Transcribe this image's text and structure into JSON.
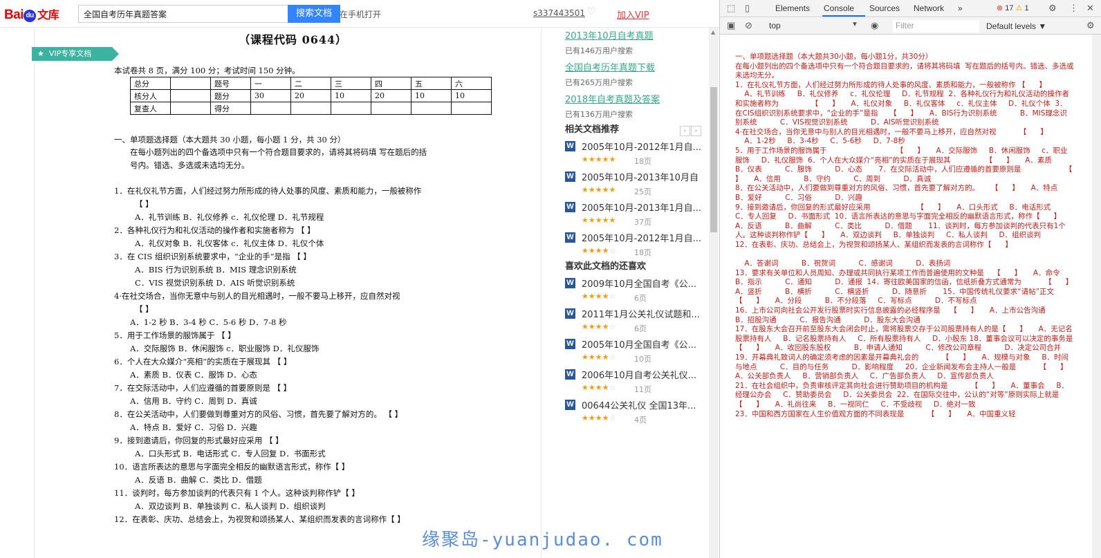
{
  "browser": {
    "logo": {
      "part1": "Bai",
      "paw": "du",
      "part2": "文库"
    },
    "search": {
      "value": "全国自考历年真题答案",
      "button": "搜索文档"
    },
    "open_on_phone": "在手机打开",
    "username": "s337443501",
    "join_vip": "加入VIP",
    "vip_tag": "VIP专享文档"
  },
  "document": {
    "title": "（课程代码 0644）",
    "intro": "本试卷共 8 页，满分 100 分；考试时间 150 分钟。",
    "score_table": [
      [
        "总分",
        "",
        "题号",
        "一",
        "二",
        "三",
        "四",
        "五",
        "六"
      ],
      [
        "核分人",
        "",
        "题分",
        "30",
        "20",
        "10",
        "20",
        "10",
        "10"
      ],
      [
        "复查人",
        "",
        "得分",
        "",
        "",
        "",
        "",
        "",
        ""
      ]
    ],
    "lines": [
      "一、单项题选择题（本大题共 30 小题，每小题 1 分，共 30 分）",
      "在每小题列出的四个备选项中只有一个符合题目要求的，请将其将码填   写在题后的括",
      "号内。错选、多选或未选均无分。",
      "1．在礼仪礼节方面，人们经过努力所形成的待人处事的风度、素质和能力，一般被称作",
      "【      】",
      "A．礼节训练     B．礼仪修养     c．礼仪伦理     D．礼节规程",
      "2．各种礼仪行为和礼仪活动的操作者和实施者称为              【      】",
      "A．礼仪对象     B．礼仪客体     c．礼仪主体     D．礼仪个体",
      "3．在 CIS 组织识别系统要求中，“企业的手”是指     【      】",
      "A．BIS 行为识别系统          B．MIS 理念识别系统",
      "C．VIS 视觉识别系统          D．AIS 听觉识别系统",
      "4·在社交场合，当你无意中与别人的目光相遇时，一般不要马上移开，应自然对视",
      "【      】",
      "A．1-2 秒     B．3-4 秒     C．5-6 秒     D．7-8 秒",
      "5．用于工作场景的服饰属于                              【      】",
      "A．交际服饰     B．休闲服饰     c．职业服饰     D．礼仪服饰",
      "6．个人在大众媒介“亮相”的实质在于展现其               【      】",
      "A．素质     B．仪表          C．服饰          D．心态",
      "7．在交际活动中，人们应遵循的首要原则是                   【      】",
      "A．信用          B．守约          C．周到          D．真诚",
      "8．在公关活动中，人们要做到尊重对方的风俗、习惯，首先要了解对方的。     【      】",
      "A．特点          B．爱好          C．习俗          D．兴趣",
      "9．接到邀请后，你回复的形式最好应采用                    【      】",
      "A．口头形式     B．电话形式     C．专人回复     D．书面形式",
      "10．语言所表达的意思与字面完全相反的幽默语言形式，称作【      】",
      "A．反语          B．曲解          C．类比          D．借题",
      "11．谈判时，每方参加谈判的代表只有 1 个人。这种谈判称作铲【      】",
      "A．双边谈判     B．单独谈判     C．私人谈判     D．组织谈判",
      "12．在表彰、庆功、总结会上，为视贺和颂扬某人、某组织而发表的言词称作【      】"
    ]
  },
  "sidebar": {
    "hot_searches": [
      {
        "title": "2013年10月自考真题",
        "count": "已有146万用户搜索"
      },
      {
        "title": "全国自考历年真题下载",
        "count": "已有265万用户搜索"
      },
      {
        "title": "2018年自考真题及答案",
        "count": "已有136万用户搜索"
      }
    ],
    "related_heading": "相关文档推荐",
    "related": [
      {
        "title": "2005年10月-2012年1月自...",
        "stars": 4.5,
        "pages": "18页"
      },
      {
        "title": "2005年10月-2013年10月自",
        "stars": 4.5,
        "pages": "25页"
      },
      {
        "title": "2005年10月-2013年1月自...",
        "stars": 4.5,
        "pages": "37页"
      },
      {
        "title": "2005年10月-2012年1月自...",
        "stars": 3.5,
        "pages": "18页"
      }
    ],
    "also_liked_heading": "喜欢此文档的还喜欢",
    "also_liked": [
      {
        "title": "2009年10月全国自考《公...",
        "stars": 4,
        "pages": "6页"
      },
      {
        "title": "2011年1月公关礼仪试题和...",
        "stars": 4,
        "pages": "6页"
      },
      {
        "title": "2005年10月全国自考《公...",
        "stars": 4,
        "pages": "10页"
      },
      {
        "title": "2006年10月自考公关礼仪...",
        "stars": 4,
        "pages": "11页"
      },
      {
        "title": "00644公关礼仪 全国13年...",
        "stars": 4,
        "pages": "4页"
      }
    ]
  },
  "watermark": "缘聚岛-yuanjudao. com",
  "devtools": {
    "tabs": [
      "Elements",
      "Console",
      "Sources",
      "Network"
    ],
    "active_tab": "Console",
    "more": "»",
    "errors": "17",
    "warnings": "1",
    "context": "top",
    "filter_placeholder": "Filter",
    "levels": "Default levels ▼",
    "console_text": "一、单项题选择题（本大题共30小题，每小题1分，共30分）\n在每小题列出的四个备选项中只有一个符合题目要求的，请将其将码填  写在题后的括号内。错选、多选或未选均无分。\n1．在礼仪礼节方面，人们经过努力所形成的待人处事的风度、素质和能力，一般被称作 【      】\n    A．礼节训练     B．礼仪修养     c．礼仪伦理     D．礼节规程  2．各种礼仪行为和礼仪活动的操作者和实施者称为              【      】     A．礼仪对象     B．礼仪客体     c．礼仪主体     D．礼仪个体  3．在CIS组织识别系统要求中，“企业的手”是指     【      】     A．BIS行为识别系统          B．MIS理念识别系统          C．VIS视觉识别系统          D．AIS听觉识别系统\n4·在社交场合，当你无意中与别人的目光相遇时，一般不要马上移开，应自然对视          【      】\n    A．1-2秒     B．3-4秒     C．5-6秒     D．7-8秒\n5．用于工作场景的服饰属于                              【      】     A．交际服饰     B．休闲服饰     c．职业服饰     D．礼仪服饰  6．个人在大众媒介“亮相”的实质在于展现其               【      】     A．素质     B．仪表          C．服饰          D．心态       7．在交际活动中，人们应遵循的首要原则是                   【      】     A．信用          B．守约          C．周到          D．真诚\n8．在公关活动中，人们要做到尊重对方的风俗、习惯，首先要了解对方的。     【      】     A．特点          B．爱好          C．习俗          D．兴趣\n9．接到邀请后，你回复的形式最好应采用                    【      】     A．口头形式     B．电话形式     C．专人回复     D．书面形式  10．语言所表达的意思与字面完全相反的幽默语言形式，称作【      】     A．反语          B．曲解          C．类比          D．借题       11．谈判时，每方参加谈判的代表只有1个人。这种谈判称作铲【      】     A．双边谈判     B．单独谈判     C．私人谈判     D．组织谈判\n12．在表彰、庆功、总结会上，为视贺和颂扬某人、某组织而发表的言词称作【      】\n\n    A．答谢词          B．祝贺词          C．感谢词          D．表扬词\n13．要求有关单位和人员周知、办理或共同执行某项工作而普遍使用的文种是    【      】     A．命令          B．指示          C．通知          D．通报  14．寄往欧美国家的信函，信纸折叠方式通常为          【      】     A．竖折          B．横折          C．横竖折          D．随意折       15．中国传统礼仪要求“请帖”正文      【      】     A．分段          B．不分段落     C．写标点          D．不写标点\n16．上市公司向社会公开发行股票时实行信息披露的必经程序是    【      】     A．上市公告沟通          B．招股沟通          C．报告沟通          D．股东大会沟通\n17．在股东大会召开前至股东大会闭会时止，需将股票交存于公司股票持有人的是【      】     A．无记名股票持有人     B．记名股票持有人     C．所有股票持有人     D．小股东 18．董事会议可以决定的事务是   【      】     A．收回股东股权          B．申请人通知          C．修改公司章程          D．决定公司合并\n19．开幕典礼致词人的确定须考虑的因素是开幕典礼会的          【      】     A．规模与对象     B．时间与地点          C．目的与任务          D．影响程度     20．企业新闻发布会主持人一般是          【      】     A．公关部负责人     B．营销部负责人     C．广告部负责人     D．宣传部负责人\n21．在社会组织中，负责审核评定其向社会进行赞助项目的机构是          【      】     A．董事会     B．经理公办会     C．赞助委员会     D．公关委员会  22．在国际交往中，公认的“对等”原则实际上就是          【      】     A．礼尚往来     B．一视同仁     C．不受歧视     D．绝对一致\n23．中国和西方国家在人生价值观方面的不同表现是          【      】     A．中国重义轻"
  }
}
